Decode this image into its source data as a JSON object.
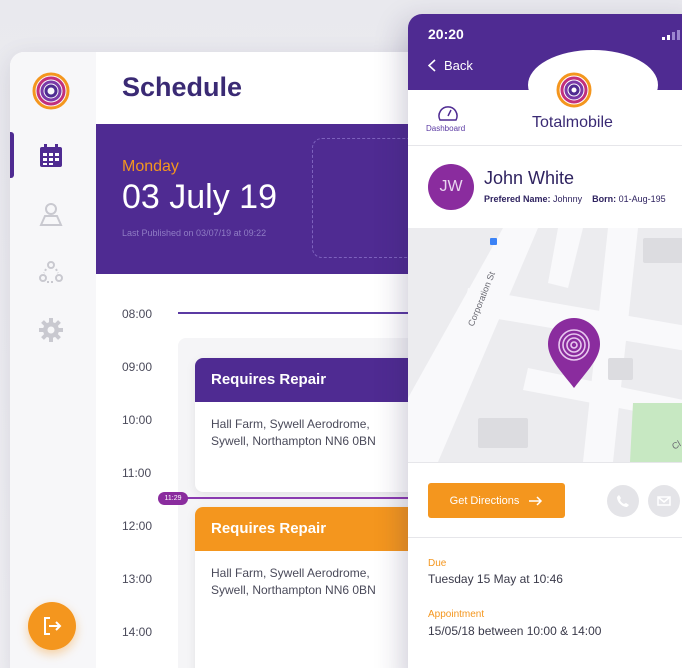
{
  "schedule": {
    "title": "Schedule",
    "day": "Monday",
    "date": "03 July 19",
    "published": "Last Published on 03/07/19 at 09:22",
    "times": [
      "08:00",
      "09:00",
      "10:00",
      "11:00",
      "12:00",
      "13:00",
      "14:00"
    ],
    "now_marker": "11:29",
    "jobs": [
      {
        "title": "Requires Repair",
        "address_line1": "Hall Farm, Sywell Aerodrome,",
        "address_line2": "Sywell, Northampton NN6 0BN",
        "color": "#4f2b92"
      },
      {
        "title": "Requires Repair",
        "address_line1": "Hall Farm, Sywell Aerodrome,",
        "address_line2": "Sywell, Northampton NN6 0BN",
        "color": "#f4961e"
      }
    ]
  },
  "sidebar": {
    "icons": [
      "logo-icon",
      "calendar-icon",
      "map-pin-person-icon",
      "team-icon",
      "gear-icon",
      "logout-icon"
    ]
  },
  "phone": {
    "status_time": "20:20",
    "back_label": "Back",
    "brand": "Totalmobile",
    "dashboard_label": "Dashboard",
    "contact": {
      "initials": "JW",
      "name": "John White",
      "preferred_label": "Prefered Name:",
      "preferred_value": "Johnny",
      "born_label": "Born:",
      "born_value": "01-Aug-195"
    },
    "map": {
      "street_label": "Corporation St",
      "partial_label": "Cl"
    },
    "directions_label": "Get Directions",
    "due_label": "Due",
    "due_value": "Tuesday 15 May at 10:46",
    "appointment_label": "Appointment",
    "appointment_value": "15/05/18 between 10:00 & 14:00"
  },
  "colors": {
    "brand_purple": "#4f2b92",
    "accent_orange": "#f4961e",
    "avatar_magenta": "#8a2c9e",
    "map_green": "#c7e8c2"
  }
}
